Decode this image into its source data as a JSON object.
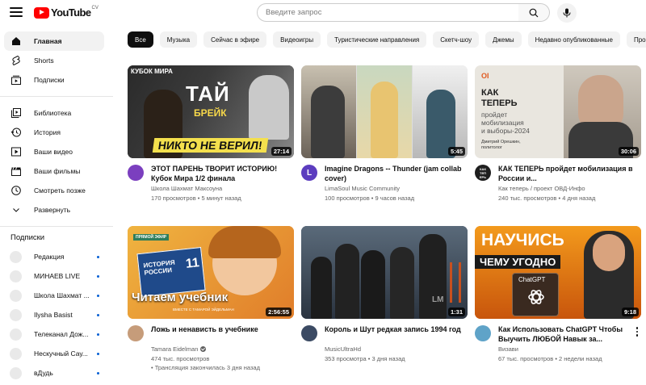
{
  "header": {
    "logo_text": "YouTube",
    "logo_country": "CV",
    "search_placeholder": "Введите запрос"
  },
  "sidebar": {
    "items": [
      {
        "label": "Главная",
        "icon": "home-icon",
        "active": true
      },
      {
        "label": "Shorts",
        "icon": "shorts-icon"
      },
      {
        "label": "Подписки",
        "icon": "subscriptions-icon"
      }
    ],
    "library_items": [
      {
        "label": "Библиотека",
        "icon": "library-icon"
      },
      {
        "label": "История",
        "icon": "history-icon"
      },
      {
        "label": "Ваши видео",
        "icon": "your-videos-icon"
      },
      {
        "label": "Ваши фильмы",
        "icon": "your-movies-icon"
      },
      {
        "label": "Смотреть позже",
        "icon": "watch-later-icon"
      },
      {
        "label": "Развернуть",
        "icon": "chevron-down-icon"
      }
    ],
    "subscriptions_title": "Подписки",
    "subscriptions": [
      {
        "label": "Редакция"
      },
      {
        "label": "МИНАЕВ LIVE"
      },
      {
        "label": "Школа Шахмат ..."
      },
      {
        "label": "Ilysha Basist"
      },
      {
        "label": "Телеканал Дож..."
      },
      {
        "label": "Нескучный Сау..."
      },
      {
        "label": "вДудь"
      }
    ]
  },
  "chips": [
    "Все",
    "Музыка",
    "Сейчас в эфире",
    "Видеоигры",
    "Туристические направления",
    "Скетч-шоу",
    "Джемы",
    "Недавно опубликованные",
    "Прос"
  ],
  "videos": [
    {
      "title": "ЭТОТ ПАРЕНЬ ТВОРИТ ИСТОРИЮ! Кубок Мира 1/2 финала",
      "channel": "Школа Шахмат Максоуна",
      "meta": "170 просмотров • 5 минут назад",
      "duration": "27:14",
      "thumb_text": {
        "top": "КУБОК МИРА",
        "big": "ТАЙ",
        "big2": "БРЕЙК",
        "bottom": "НИКТО НЕ ВЕРИЛ!"
      }
    },
    {
      "title": "Imagine Dragons -- Thunder (jam collab cover)",
      "channel": "LimaSoul Music Community",
      "meta": "100 просмотров • 9 часов назад",
      "duration": "5:45",
      "avatar_letter": "L"
    },
    {
      "title": "КАК ТЕПЕРЬ пройдет мобилизация в России и...",
      "channel": "Как теперь / проект ОВД-Инфо",
      "meta": "240 тыс. просмотров • 4 дня назад",
      "duration": "30:06",
      "avatar_text": "КАК ТЕП ЕРЬ",
      "thumb_text": {
        "brand": "OI",
        "l1": "КАК",
        "l2": "ТЕПЕРЬ",
        "l3": "пройдет",
        "l4": "мобилизация",
        "l5": "и выборы-2024",
        "caption": "Дмитрий Орешкин, политолог"
      }
    },
    {
      "title": "Ложь и ненависть в учебнике",
      "channel": "Tamara Eidelman",
      "meta": "474 тыс. просмотров",
      "meta2": "• Трансляция закончилась 3 дня назад",
      "duration": "2:56:55",
      "thumb_text": {
        "badge": "ПРЯМОЙ ЭФИР",
        "book": "ИСТОРИЯ РОССИИ",
        "num": "11",
        "bottom": "Читаем учебник",
        "sub": "ВМЕСТЕ С ТАМАРОЙ ЭЙДЕЛЬМАН"
      }
    },
    {
      "title": "Король и Шут редкая запись 1994 год",
      "channel": "MusicUltraHd",
      "meta": "353 просмотра • 3 дня назад",
      "duration": "1:31",
      "thumb_text": {
        "wm": "LM"
      }
    },
    {
      "title": "Как Использовать ChatGPT Чтобы Выучить ЛЮБОЙ Навык за...",
      "channel": "Визави",
      "meta": "67 тыс. просмотров • 2 недели назад",
      "duration": "9:18",
      "thumb_text": {
        "l1": "НАУЧИСЬ",
        "l2": "ЧЕМУ УГОДНО",
        "logo": "ChatGPT"
      }
    }
  ],
  "colors": {
    "brand": "#ff0000",
    "chip_active": "#0f0f0f",
    "chip": "#f2f2f2",
    "meta": "#606060"
  }
}
